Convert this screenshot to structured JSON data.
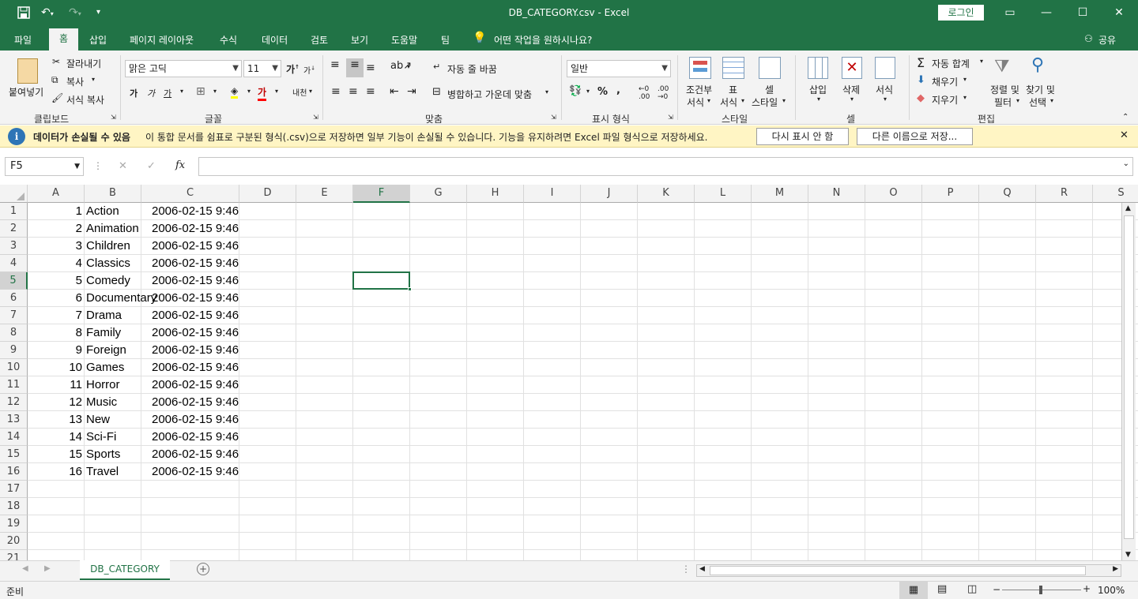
{
  "titlebar": {
    "title": "DB_CATEGORY.csv  -  Excel",
    "login_label": "로그인"
  },
  "menu": {
    "tabs": [
      "파일",
      "홈",
      "삽입",
      "페이지 레이아웃",
      "수식",
      "데이터",
      "검토",
      "보기",
      "도움말",
      "팀"
    ],
    "tell_me": "어떤 작업을 원하시나요?",
    "share": "공유"
  },
  "ribbon": {
    "clipboard": {
      "paste": "붙여넣기",
      "cut": "잘라내기",
      "copy": "복사",
      "format_painter": "서식 복사",
      "label": "클립보드"
    },
    "font": {
      "name": "맑은 고딕",
      "size": "11",
      "label": "글꼴"
    },
    "alignment": {
      "wrap": "자동 줄 바꿈",
      "merge": "병합하고 가운데 맞춤",
      "label": "맞춤"
    },
    "number": {
      "format": "일반",
      "label": "표시 형식"
    },
    "styles": {
      "conditional_1": "조건부",
      "conditional_2": "서식",
      "table_1": "표",
      "table_2": "서식",
      "cell_1": "셀",
      "cell_2": "스타일",
      "label": "스타일"
    },
    "cells": {
      "insert": "삽입",
      "delete": "삭제",
      "format": "서식",
      "label": "셀"
    },
    "editing": {
      "autosum": "자동 합계",
      "fill": "채우기",
      "clear": "지우기",
      "sort_1": "정렬 및",
      "sort_2": "필터",
      "find_1": "찾기 및",
      "find_2": "선택",
      "label": "편집"
    }
  },
  "message": {
    "title": "데이터가 손실될 수 있음",
    "text": "이 통합 문서를 쉼표로 구분된 형식(.csv)으로 저장하면 일부 기능이 손실될 수 있습니다. 기능을 유지하려면 Excel 파일 형식으로 저장하세요.",
    "btn_dismiss": "다시 표시 안 함",
    "btn_saveas": "다른 이름으로 저장..."
  },
  "formula": {
    "namebox": "F5",
    "cancel": "✕",
    "enter": "✓",
    "fx": "fx",
    "content": ""
  },
  "columns": [
    "A",
    "B",
    "C",
    "D",
    "E",
    "F",
    "G",
    "H",
    "I",
    "J",
    "K",
    "L",
    "M",
    "N",
    "O",
    "P",
    "Q",
    "R",
    "S"
  ],
  "rows": [
    {
      "n": "1",
      "a": "1",
      "b": "Action",
      "c": "2006-02-15 9:46"
    },
    {
      "n": "2",
      "a": "2",
      "b": "Animation",
      "c": "2006-02-15 9:46"
    },
    {
      "n": "3",
      "a": "3",
      "b": "Children",
      "c": "2006-02-15 9:46"
    },
    {
      "n": "4",
      "a": "4",
      "b": "Classics",
      "c": "2006-02-15 9:46"
    },
    {
      "n": "5",
      "a": "5",
      "b": "Comedy",
      "c": "2006-02-15 9:46"
    },
    {
      "n": "6",
      "a": "6",
      "b": "Documentary",
      "c": "2006-02-15 9:46"
    },
    {
      "n": "7",
      "a": "7",
      "b": "Drama",
      "c": "2006-02-15 9:46"
    },
    {
      "n": "8",
      "a": "8",
      "b": "Family",
      "c": "2006-02-15 9:46"
    },
    {
      "n": "9",
      "a": "9",
      "b": "Foreign",
      "c": "2006-02-15 9:46"
    },
    {
      "n": "10",
      "a": "10",
      "b": "Games",
      "c": "2006-02-15 9:46"
    },
    {
      "n": "11",
      "a": "11",
      "b": "Horror",
      "c": "2006-02-15 9:46"
    },
    {
      "n": "12",
      "a": "12",
      "b": "Music",
      "c": "2006-02-15 9:46"
    },
    {
      "n": "13",
      "a": "13",
      "b": "New",
      "c": "2006-02-15 9:46"
    },
    {
      "n": "14",
      "a": "14",
      "b": "Sci-Fi",
      "c": "2006-02-15 9:46"
    },
    {
      "n": "15",
      "a": "15",
      "b": "Sports",
      "c": "2006-02-15 9:46"
    },
    {
      "n": "16",
      "a": "16",
      "b": "Travel",
      "c": "2006-02-15 9:46"
    },
    {
      "n": "17",
      "a": "",
      "b": "",
      "c": ""
    },
    {
      "n": "18",
      "a": "",
      "b": "",
      "c": ""
    },
    {
      "n": "19",
      "a": "",
      "b": "",
      "c": ""
    },
    {
      "n": "20",
      "a": "",
      "b": "",
      "c": ""
    },
    {
      "n": "21",
      "a": "",
      "b": "",
      "c": ""
    }
  ],
  "sheet": {
    "tab": "DB_CATEGORY"
  },
  "status": {
    "ready": "준비",
    "zoom": "100%"
  },
  "colors": {
    "accent": "#217346",
    "message_bg": "#fff5c4"
  }
}
